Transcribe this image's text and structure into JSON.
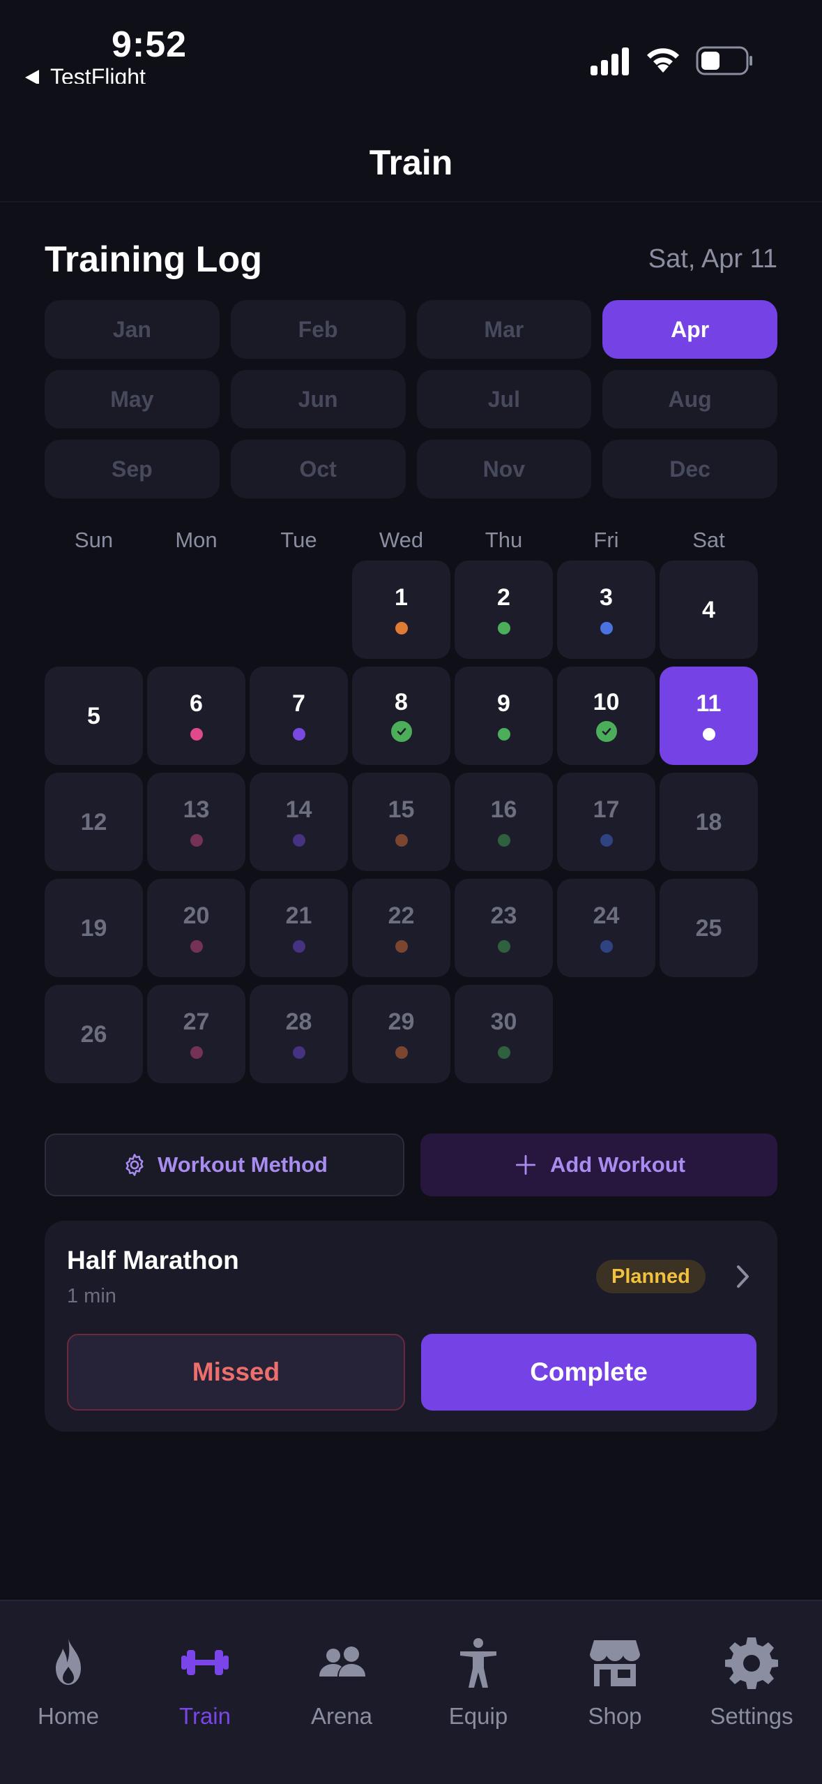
{
  "status_bar": {
    "time": "9:52",
    "back_app": "TestFlight"
  },
  "header": {
    "title": "Train"
  },
  "training_log": {
    "title": "Training Log",
    "current_date": "Sat, Apr 11",
    "months": [
      "Jan",
      "Feb",
      "Mar",
      "Apr",
      "May",
      "Jun",
      "Jul",
      "Aug",
      "Sep",
      "Oct",
      "Nov",
      "Dec"
    ],
    "selected_month": "Apr",
    "weekdays": [
      "Sun",
      "Mon",
      "Tue",
      "Wed",
      "Thu",
      "Fri",
      "Sat"
    ],
    "first_weekday_index": 3,
    "today": 11,
    "days": [
      {
        "day": "1",
        "marker": "dot",
        "color": "#e07b34"
      },
      {
        "day": "2",
        "marker": "dot",
        "color": "#4cae5a"
      },
      {
        "day": "3",
        "marker": "dot",
        "color": "#4a72e0"
      },
      {
        "day": "4",
        "marker": "none",
        "color": ""
      },
      {
        "day": "5",
        "marker": "none",
        "color": ""
      },
      {
        "day": "6",
        "marker": "dot",
        "color": "#e04a8c"
      },
      {
        "day": "7",
        "marker": "dot",
        "color": "#7a4ae0"
      },
      {
        "day": "8",
        "marker": "check",
        "color": "#4cae5a"
      },
      {
        "day": "9",
        "marker": "dot",
        "color": "#4cae5a"
      },
      {
        "day": "10",
        "marker": "check",
        "color": "#4cae5a"
      },
      {
        "day": "11",
        "marker": "dot",
        "color": "#ffffff"
      },
      {
        "day": "12",
        "marker": "none",
        "color": ""
      },
      {
        "day": "13",
        "marker": "dot",
        "color": "#c0467c"
      },
      {
        "day": "14",
        "marker": "dot",
        "color": "#6a46c8"
      },
      {
        "day": "15",
        "marker": "dot",
        "color": "#c86a34"
      },
      {
        "day": "16",
        "marker": "dot",
        "color": "#3f9a4e"
      },
      {
        "day": "17",
        "marker": "dot",
        "color": "#3f62c8"
      },
      {
        "day": "18",
        "marker": "none",
        "color": ""
      },
      {
        "day": "19",
        "marker": "none",
        "color": ""
      },
      {
        "day": "20",
        "marker": "dot",
        "color": "#c0467c"
      },
      {
        "day": "21",
        "marker": "dot",
        "color": "#6a46c8"
      },
      {
        "day": "22",
        "marker": "dot",
        "color": "#c86a34"
      },
      {
        "day": "23",
        "marker": "dot",
        "color": "#3f9a4e"
      },
      {
        "day": "24",
        "marker": "dot",
        "color": "#3f62c8"
      },
      {
        "day": "25",
        "marker": "none",
        "color": ""
      },
      {
        "day": "26",
        "marker": "none",
        "color": ""
      },
      {
        "day": "27",
        "marker": "dot",
        "color": "#c0467c"
      },
      {
        "day": "28",
        "marker": "dot",
        "color": "#6a46c8"
      },
      {
        "day": "29",
        "marker": "dot",
        "color": "#c86a34"
      },
      {
        "day": "30",
        "marker": "dot",
        "color": "#3f9a4e"
      }
    ]
  },
  "actions": {
    "workout_method_label": "Workout Method",
    "add_workout_label": "Add Workout"
  },
  "workout_card": {
    "title": "Half Marathon",
    "duration": "1 min",
    "status": "Planned",
    "missed_label": "Missed",
    "complete_label": "Complete"
  },
  "tabbar": {
    "items": [
      {
        "label": "Home",
        "icon": "flame-icon"
      },
      {
        "label": "Train",
        "icon": "dumbbell-icon"
      },
      {
        "label": "Arena",
        "icon": "users-icon"
      },
      {
        "label": "Equip",
        "icon": "person-icon"
      },
      {
        "label": "Shop",
        "icon": "store-icon"
      },
      {
        "label": "Settings",
        "icon": "gear-icon"
      }
    ],
    "active": "Train"
  },
  "colors": {
    "accent": "#7542e6",
    "background": "#0f0f17",
    "missed": "#ec6f6c",
    "planned": "#f2c13d"
  }
}
